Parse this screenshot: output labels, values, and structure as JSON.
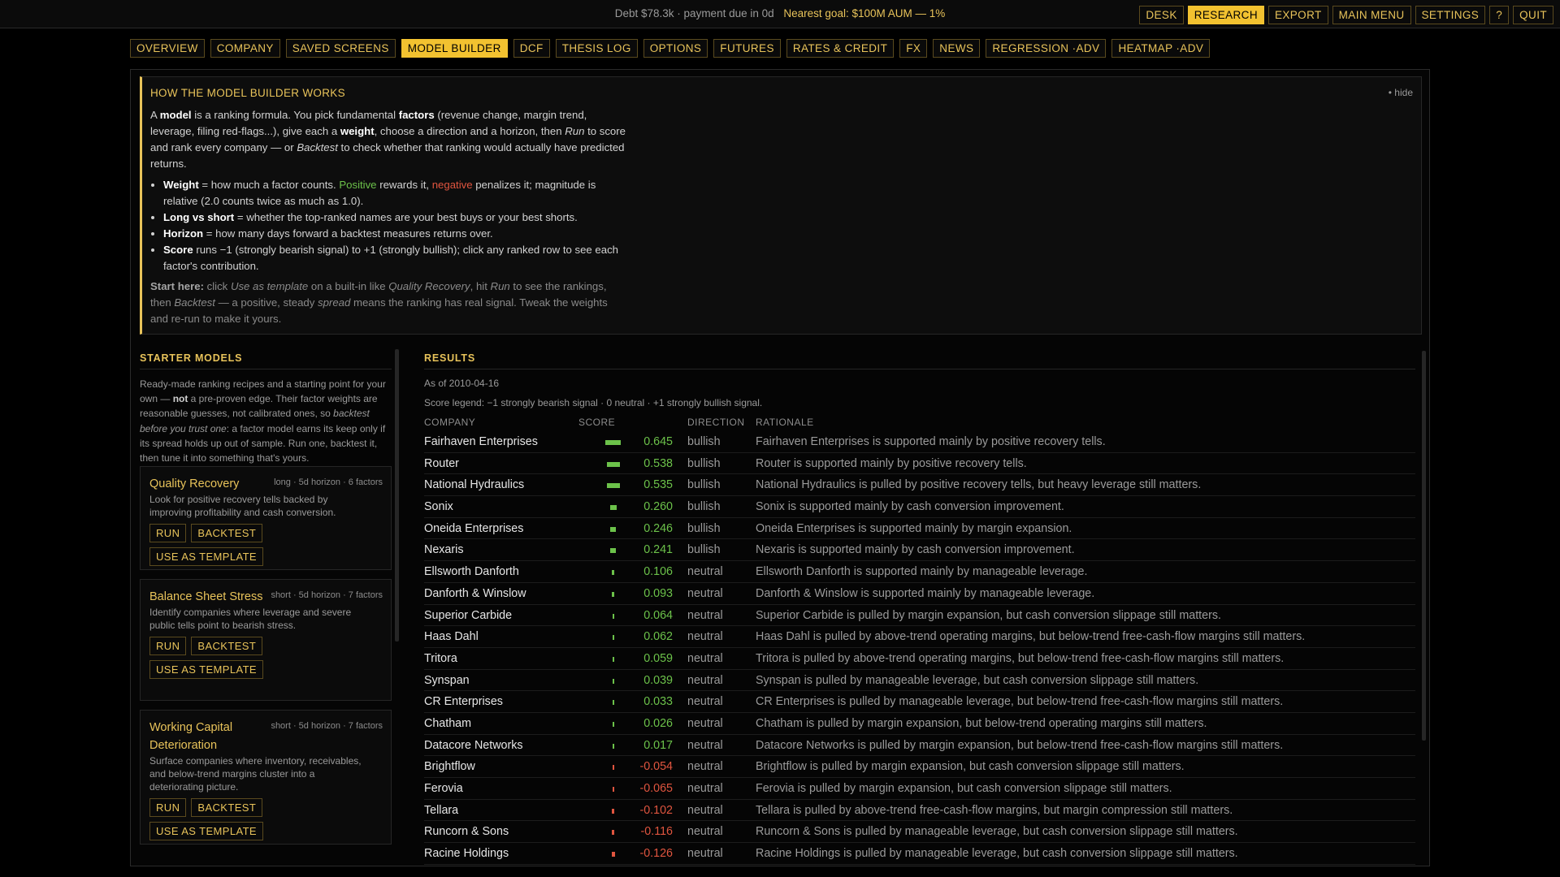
{
  "status": {
    "debt_text": "Debt $78.3k · payment due in 0d",
    "goal_text": "Nearest goal: $100M AUM — 1%"
  },
  "top_buttons": [
    {
      "label": "DESK",
      "active": false
    },
    {
      "label": "RESEARCH",
      "active": true
    },
    {
      "label": "EXPORT",
      "active": false
    },
    {
      "label": "MAIN MENU",
      "active": false
    },
    {
      "label": "SETTINGS",
      "active": false
    },
    {
      "label": "?",
      "active": false
    },
    {
      "label": "QUIT",
      "active": false
    }
  ],
  "tabs": [
    {
      "label": "OVERVIEW",
      "active": false
    },
    {
      "label": "COMPANY",
      "active": false
    },
    {
      "label": "SAVED SCREENS",
      "active": false
    },
    {
      "label": "MODEL BUILDER",
      "active": true
    },
    {
      "label": "DCF",
      "active": false
    },
    {
      "label": "THESIS LOG",
      "active": false
    },
    {
      "label": "OPTIONS",
      "active": false
    },
    {
      "label": "FUTURES",
      "active": false
    },
    {
      "label": "RATES & CREDIT",
      "active": false
    },
    {
      "label": "FX",
      "active": false
    },
    {
      "label": "NEWS",
      "active": false
    },
    {
      "label": "REGRESSION ·ADV",
      "active": false
    },
    {
      "label": "HEATMAP ·ADV",
      "active": false
    }
  ],
  "help": {
    "title": "HOW THE MODEL BUILDER WORKS",
    "hide_label": "• hide",
    "intro": {
      "p1": "A ",
      "b1": "model",
      "p2": " is a ranking formula. You pick fundamental ",
      "b2": "factors",
      "p3": " (revenue change, margin trend, leverage, filing red-flags...), give each a ",
      "b3": "weight",
      "p4": ", choose a direction and a horizon, then ",
      "i1": "Run",
      "p5": " to score and rank every company — or ",
      "i2": "Backtest",
      "p6": " to check whether that ranking would actually have predicted returns."
    },
    "bullets": {
      "weight_b": "Weight",
      "weight_t1": " = how much a factor counts. ",
      "weight_pos": "Positive",
      "weight_t2": " rewards it, ",
      "weight_neg": "negative",
      "weight_t3": " penalizes it; magnitude is relative (2.0 counts twice as much as 1.0).",
      "long_b": "Long vs short",
      "long_t": " = whether the top-ranked names are your best buys or your best shorts.",
      "horizon_b": "Horizon",
      "horizon_t": " = how many days forward a backtest measures returns over.",
      "score_b": "Score",
      "score_t": " runs −1 (strongly bearish signal) to +1 (strongly bullish); click any ranked row to see each factor's contribution."
    },
    "start": {
      "b": "Start here:",
      "t1": " click ",
      "i1": "Use as template",
      "t2": " on a built-in like ",
      "i2": "Quality Recovery",
      "t3": ", hit ",
      "i3": "Run",
      "t4": " to see the rankings, then ",
      "i4": "Backtest",
      "t5": " — a positive, steady ",
      "i5": "spread",
      "t6": " means the ranking has real signal. Tweak the weights and re-run to make it yours."
    }
  },
  "starter": {
    "title": "STARTER MODELS",
    "intro": {
      "t1": "Ready-made ranking recipes and a starting point for your own — ",
      "b": "not",
      "t2": " a pre-proven edge. Their factor weights are reasonable guesses, not calibrated ones, so ",
      "i": "backtest before you trust one",
      "t3": ": a factor model earns its keep only if its spread holds up out of sample. Run one, backtest it, then tune it into something that's yours."
    },
    "run_label": "RUN",
    "backtest_label": "BACKTEST",
    "template_label": "USE AS TEMPLATE",
    "models": [
      {
        "name": "Quality Recovery",
        "meta": "long · 5d horizon · 6 factors",
        "desc": "Look for positive recovery tells backed by improving profitability and cash conversion."
      },
      {
        "name": "Balance Sheet Stress",
        "meta": "short · 5d horizon · 7 factors",
        "desc": "Identify companies where leverage and severe public tells point to bearish stress."
      },
      {
        "name": "Working Capital Deterioration",
        "meta": "short · 5d horizon · 7 factors",
        "desc": "Surface companies where inventory, receivables, and below-trend margins cluster into a deteriorating picture."
      }
    ]
  },
  "results": {
    "title": "RESULTS",
    "as_of": "As of 2010-04-16",
    "legend": "Score legend: −1 strongly bearish signal · 0 neutral · +1 strongly bullish signal.",
    "headers": {
      "company": "COMPANY",
      "score": "SCORE",
      "direction": "DIRECTION",
      "rationale": "RATIONALE"
    },
    "colors": {
      "positive": "#6cc24a",
      "negative": "#e0553f"
    },
    "rows": [
      {
        "company": "Fairhaven Enterprises",
        "score": 0.645,
        "score_text": "0.645",
        "direction": "bullish",
        "rationale": "Fairhaven Enterprises is supported mainly by positive recovery tells."
      },
      {
        "company": "Router",
        "score": 0.538,
        "score_text": "0.538",
        "direction": "bullish",
        "rationale": "Router is supported mainly by positive recovery tells."
      },
      {
        "company": "National Hydraulics",
        "score": 0.535,
        "score_text": "0.535",
        "direction": "bullish",
        "rationale": "National Hydraulics is pulled by positive recovery tells, but heavy leverage still matters."
      },
      {
        "company": "Sonix",
        "score": 0.26,
        "score_text": "0.260",
        "direction": "bullish",
        "rationale": "Sonix is supported mainly by cash conversion improvement."
      },
      {
        "company": "Oneida Enterprises",
        "score": 0.246,
        "score_text": "0.246",
        "direction": "bullish",
        "rationale": "Oneida Enterprises is supported mainly by margin expansion."
      },
      {
        "company": "Nexaris",
        "score": 0.241,
        "score_text": "0.241",
        "direction": "bullish",
        "rationale": "Nexaris is supported mainly by cash conversion improvement."
      },
      {
        "company": "Ellsworth Danforth",
        "score": 0.106,
        "score_text": "0.106",
        "direction": "neutral",
        "rationale": "Ellsworth Danforth is supported mainly by manageable leverage."
      },
      {
        "company": "Danforth & Winslow",
        "score": 0.093,
        "score_text": "0.093",
        "direction": "neutral",
        "rationale": "Danforth & Winslow is supported mainly by manageable leverage."
      },
      {
        "company": "Superior Carbide",
        "score": 0.064,
        "score_text": "0.064",
        "direction": "neutral",
        "rationale": "Superior Carbide is pulled by margin expansion, but cash conversion slippage still matters."
      },
      {
        "company": "Haas Dahl",
        "score": 0.062,
        "score_text": "0.062",
        "direction": "neutral",
        "rationale": "Haas Dahl is pulled by above-trend operating margins, but below-trend free-cash-flow margins still matters."
      },
      {
        "company": "Tritora",
        "score": 0.059,
        "score_text": "0.059",
        "direction": "neutral",
        "rationale": "Tritora is pulled by above-trend operating margins, but below-trend free-cash-flow margins still matters."
      },
      {
        "company": "Synspan",
        "score": 0.039,
        "score_text": "0.039",
        "direction": "neutral",
        "rationale": "Synspan is pulled by manageable leverage, but cash conversion slippage still matters."
      },
      {
        "company": "CR Enterprises",
        "score": 0.033,
        "score_text": "0.033",
        "direction": "neutral",
        "rationale": "CR Enterprises is pulled by manageable leverage, but below-trend free-cash-flow margins still matters."
      },
      {
        "company": "Chatham",
        "score": 0.026,
        "score_text": "0.026",
        "direction": "neutral",
        "rationale": "Chatham is pulled by margin expansion, but below-trend operating margins still matters."
      },
      {
        "company": "Datacore Networks",
        "score": 0.017,
        "score_text": "0.017",
        "direction": "neutral",
        "rationale": "Datacore Networks is pulled by margin expansion, but below-trend free-cash-flow margins still matters."
      },
      {
        "company": "Brightflow",
        "score": -0.054,
        "score_text": "-0.054",
        "direction": "neutral",
        "rationale": "Brightflow is pulled by margin expansion, but cash conversion slippage still matters."
      },
      {
        "company": "Ferovia",
        "score": -0.065,
        "score_text": "-0.065",
        "direction": "neutral",
        "rationale": "Ferovia is pulled by margin expansion, but cash conversion slippage still matters."
      },
      {
        "company": "Tellara",
        "score": -0.102,
        "score_text": "-0.102",
        "direction": "neutral",
        "rationale": "Tellara is pulled by above-trend free-cash-flow margins, but margin compression still matters."
      },
      {
        "company": "Runcorn & Sons",
        "score": -0.116,
        "score_text": "-0.116",
        "direction": "neutral",
        "rationale": "Runcorn & Sons is pulled by manageable leverage, but cash conversion slippage still matters."
      },
      {
        "company": "Racine Holdings",
        "score": -0.126,
        "score_text": "-0.126",
        "direction": "neutral",
        "rationale": "Racine Holdings is pulled by manageable leverage, but cash conversion slippage still matters."
      }
    ]
  }
}
